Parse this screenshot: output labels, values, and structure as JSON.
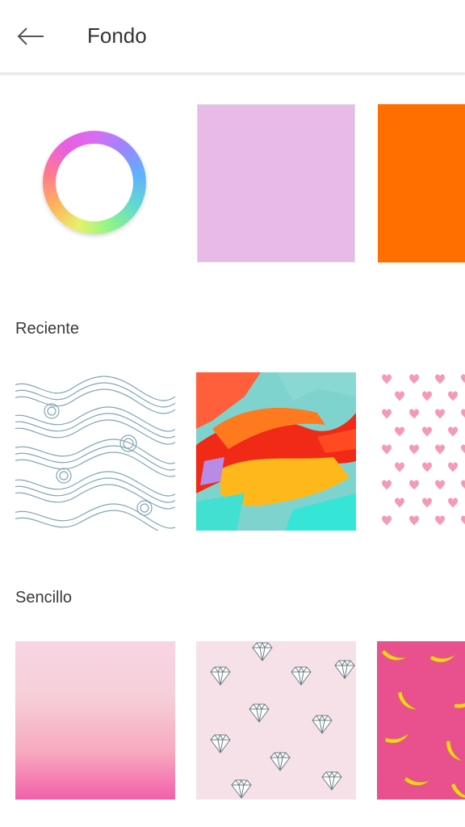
{
  "header": {
    "title": "Fondo",
    "back_icon": "arrow-left-icon"
  },
  "colors": {
    "lilac": "#e7bae8",
    "orange": "#ff6f00",
    "wave_line": "#7fa6b3",
    "heart": "#f59ab6",
    "gradient_top": "#f8d4e4",
    "gradient_bottom": "#f25faa",
    "diamond_bg": "#f6e1e8",
    "banana_bg": "#e9508e",
    "banana": "#f7d41e"
  },
  "sections": {
    "recent": "Reciente",
    "simple": "Sencillo"
  }
}
